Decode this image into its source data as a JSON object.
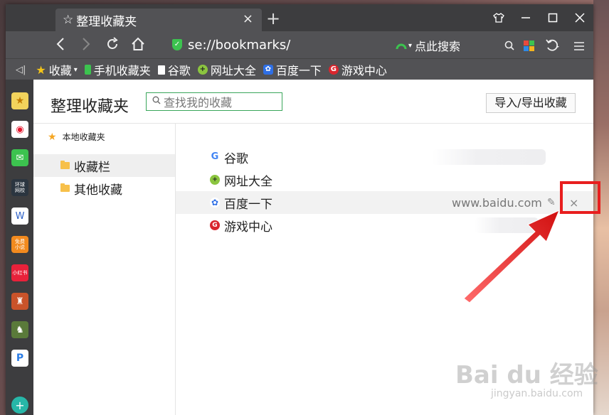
{
  "tab": {
    "title": "整理收藏夹"
  },
  "navbar": {
    "address": "se://bookmarks/",
    "search_label": "点此搜索"
  },
  "bookmarks_bar": {
    "items": [
      {
        "label": "收藏",
        "icon": "star-icon"
      },
      {
        "label": "手机收藏夹",
        "icon": "phone-icon"
      },
      {
        "label": "谷歌",
        "icon": "page-icon"
      },
      {
        "label": "网址大全",
        "icon": "plus-circle-icon"
      },
      {
        "label": "百度一下",
        "icon": "baidu-paw-icon"
      },
      {
        "label": "游戏中心",
        "icon": "game-icon"
      }
    ]
  },
  "page": {
    "title": "整理收藏夹",
    "search_placeholder": "查找我的收藏",
    "import_export": "导入/导出收藏",
    "local_label": "本地收藏夹",
    "folders": [
      {
        "label": "收藏栏"
      },
      {
        "label": "其他收藏"
      }
    ],
    "bookmarks": [
      {
        "label": "谷歌",
        "url": ""
      },
      {
        "label": "网址大全",
        "url": ""
      },
      {
        "label": "百度一下",
        "url": "www.baidu.com"
      },
      {
        "label": "游戏中心",
        "url": ""
      }
    ]
  },
  "watermark": {
    "brand": "Bai du 经验",
    "url": "jingyan.baidu.com"
  },
  "colors": {
    "accent_green": "#1fae3a",
    "highlight_red": "#e81e1e"
  }
}
